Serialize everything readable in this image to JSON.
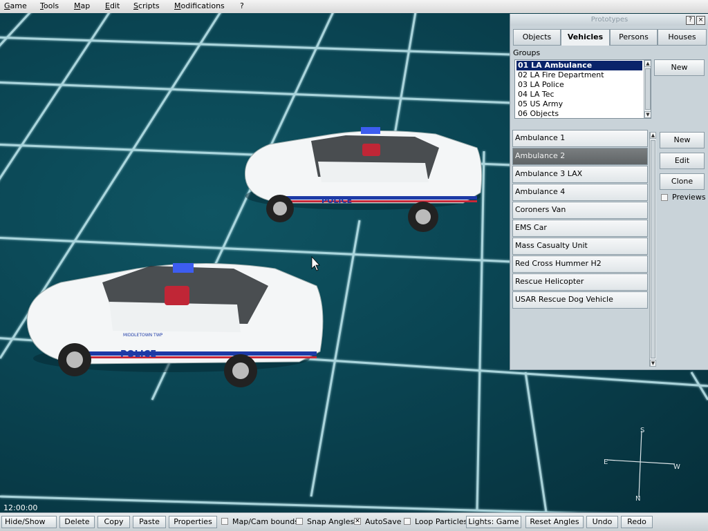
{
  "menu": {
    "items": [
      "Game",
      "Tools",
      "Map",
      "Edit",
      "Scripts",
      "Modifications",
      "?"
    ]
  },
  "prototypes_panel": {
    "title": "Prototypes",
    "help_label": "?",
    "close_label": "×",
    "tabs": [
      {
        "label": "Objects",
        "active": false
      },
      {
        "label": "Vehicles",
        "active": true
      },
      {
        "label": "Persons",
        "active": false
      },
      {
        "label": "Houses",
        "active": false
      }
    ],
    "groups_label": "Groups",
    "groups": [
      "01 LA Ambulance",
      "02 LA Fire Department",
      "03 LA Police",
      "04 LA Tec",
      "05 US Army",
      "06 Objects"
    ],
    "selected_group": "01 LA Ambulance",
    "groups_new_label": "New",
    "vehicles": [
      "Ambulance 1",
      "Ambulance 2",
      "Ambulance 3 LAX",
      "Ambulance 4",
      "Coroners Van",
      "EMS Car",
      "Mass Casualty Unit",
      "Red Cross Hummer H2",
      "Rescue Helicopter",
      "USAR Rescue Dog Vehicle"
    ],
    "selected_vehicle": "Ambulance 2",
    "buttons": {
      "new": "New",
      "edit": "Edit",
      "clone": "Clone"
    },
    "previews_label": "Previews",
    "previews_checked": false
  },
  "viewport": {
    "car_decal": "POLICE",
    "car_subdecal": "MIDDLETOWN TWP",
    "time": "12:00:00",
    "compass": {
      "n": "N",
      "s": "S",
      "e": "E",
      "w": "W"
    }
  },
  "toolbar": {
    "hide_show": "Hide/Show",
    "delete": "Delete",
    "copy": "Copy",
    "paste": "Paste",
    "properties": "Properties",
    "map_cam_bounds": {
      "label": "Map/Cam bounds",
      "checked": false
    },
    "snap_angles": {
      "label": "Snap Angles",
      "checked": false
    },
    "autosave": {
      "label": "AutoSave",
      "checked": true
    },
    "loop_particles": {
      "label": "Loop Particles",
      "checked": false
    },
    "lights": "Lights: Game",
    "reset_angles": "Reset Angles",
    "undo": "Undo",
    "redo": "Redo"
  },
  "colors": {
    "grid_line": "#c6eef4",
    "viewport_bg": "#0a4452",
    "selection": "#0a246a"
  }
}
